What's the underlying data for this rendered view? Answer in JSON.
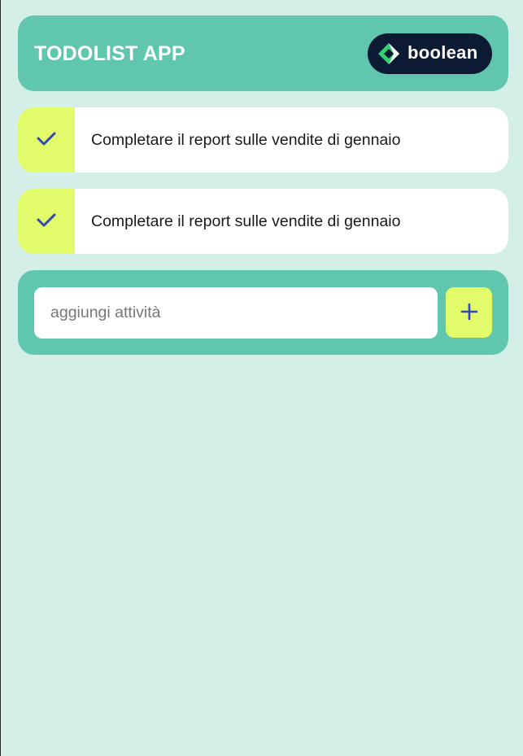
{
  "header": {
    "title": "TODOLIST APP",
    "brand_name": "boolean",
    "brand_logo_icon": "boolean-diamond-logo"
  },
  "tasks": [
    {
      "text": "Completare il report sulle vendite di gennaio",
      "icon": "check-icon",
      "done": true
    },
    {
      "text": "Completare il report sulle vendite di gennaio",
      "icon": "check-icon",
      "done": true
    }
  ],
  "add_task": {
    "placeholder": "aggiungi attività",
    "value": "",
    "button_icon": "plus-icon"
  },
  "colors": {
    "background": "#d4efe7",
    "panel": "#60c7ae",
    "accent": "#e2fb6a",
    "icon": "#3446b4",
    "brand_bg": "#0d1a33",
    "brand_green": "#2fcf72"
  }
}
